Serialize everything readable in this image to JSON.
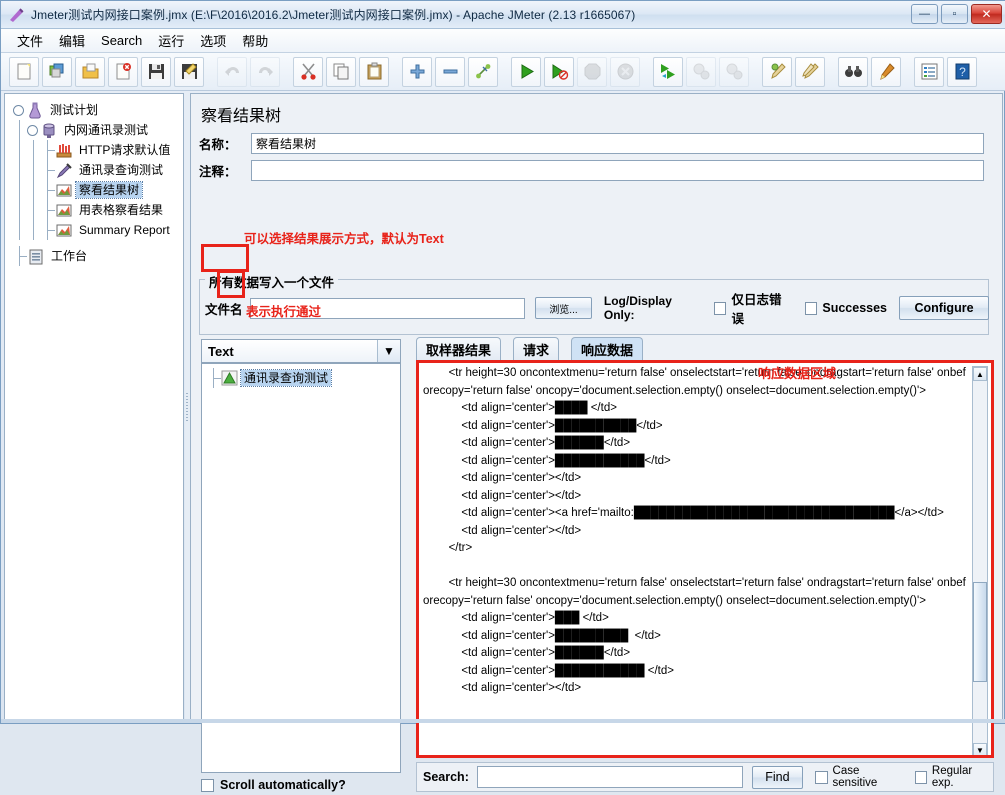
{
  "window": {
    "title": "Jmeter测试内网接口案例.jmx (E:\\F\\2016\\2016.2\\Jmeter测试内网接口案例.jmx) - Apache JMeter (2.13 r1665067)",
    "minimize_label": "—",
    "maximize_label": "▫",
    "close_label": "✕"
  },
  "menubar": {
    "items": [
      {
        "label": "文件"
      },
      {
        "label": "编辑"
      },
      {
        "label": "Search"
      },
      {
        "label": "运行"
      },
      {
        "label": "选项"
      },
      {
        "label": "帮助"
      }
    ]
  },
  "toolbar": {
    "buttons": [
      {
        "name": "new-icon",
        "enabled": true
      },
      {
        "name": "templates-icon",
        "enabled": true
      },
      {
        "name": "open-icon",
        "enabled": true
      },
      {
        "name": "close-icon",
        "enabled": true
      },
      {
        "name": "save-icon",
        "enabled": true
      },
      {
        "name": "save-as-icon",
        "enabled": true
      },
      {
        "name": "undo-icon",
        "enabled": false
      },
      {
        "name": "redo-icon",
        "enabled": false
      },
      {
        "name": "cut-icon",
        "enabled": true
      },
      {
        "name": "copy-icon",
        "enabled": true
      },
      {
        "name": "paste-icon",
        "enabled": true
      },
      {
        "name": "expand-all-icon",
        "enabled": true
      },
      {
        "name": "collapse-all-icon",
        "enabled": true
      },
      {
        "name": "toggle-icon",
        "enabled": true
      },
      {
        "name": "start-icon",
        "enabled": true
      },
      {
        "name": "start-no-timers-icon",
        "enabled": true
      },
      {
        "name": "stop-icon",
        "enabled": false
      },
      {
        "name": "shutdown-icon",
        "enabled": false
      },
      {
        "name": "start-remote-all-icon",
        "enabled": true
      },
      {
        "name": "stop-remote-all-icon",
        "enabled": false
      },
      {
        "name": "shutdown-remote-all-icon",
        "enabled": false
      },
      {
        "name": "clear-icon",
        "enabled": true
      },
      {
        "name": "clear-all-icon",
        "enabled": true
      },
      {
        "name": "search-icon",
        "enabled": true
      },
      {
        "name": "reset-search-icon",
        "enabled": true
      },
      {
        "name": "function-helper-icon",
        "enabled": true
      },
      {
        "name": "help-icon",
        "enabled": true
      }
    ]
  },
  "tree": {
    "items": [
      {
        "label": "测试计划",
        "icon": "test-plan-icon",
        "depth": 0,
        "selected": false,
        "handle": true
      },
      {
        "label": "内网通讯录测试",
        "icon": "thread-group-icon",
        "depth": 1,
        "selected": false,
        "handle": true
      },
      {
        "label": "HTTP请求默认值",
        "icon": "http-defaults-icon",
        "depth": 2,
        "selected": false,
        "handle": false
      },
      {
        "label": "通讯录查询测试",
        "icon": "http-sampler-icon",
        "depth": 2,
        "selected": false,
        "handle": false
      },
      {
        "label": "察看结果树",
        "icon": "view-results-tree-icon",
        "depth": 2,
        "selected": true,
        "handle": false
      },
      {
        "label": "用表格察看结果",
        "icon": "view-results-table-icon",
        "depth": 2,
        "selected": false,
        "handle": false
      },
      {
        "label": "Summary Report",
        "icon": "summary-report-icon",
        "depth": 2,
        "selected": false,
        "handle": false
      },
      {
        "label": "工作台",
        "icon": "workbench-icon",
        "depth": 0,
        "selected": false,
        "handle": false
      }
    ]
  },
  "panel": {
    "title": "察看结果树",
    "name_label": "名称：",
    "name_value": "察看结果树",
    "comment_label": "注释：",
    "comment_value": "",
    "group_title": "所有数据写入一个文件",
    "filename_label": "文件名",
    "filename_value": "",
    "filename_placeholder": "",
    "browse_button": "浏览...",
    "log_display_only_label": "Log/Display Only:",
    "errors_only_label": "仅日志错误",
    "successes_label": "Successes",
    "configure_button": "Configure",
    "errors_only_checked": false,
    "successes_checked": false
  },
  "renderer": {
    "selected": "Text",
    "arrow": "▼"
  },
  "result_list": {
    "items": [
      {
        "label": "通讯录查询测试",
        "status": "pass",
        "selected": true
      }
    ]
  },
  "tabs": [
    {
      "label": "取样器结果",
      "active": false
    },
    {
      "label": "请求",
      "active": false
    },
    {
      "label": "响应数据",
      "active": true
    }
  ],
  "response": {
    "text": "        <tr height=30 oncontextmenu='return false' onselectstart='return false' ondragstart='return false' onbeforecopy='return false' oncopy='document.selection.empty() onselect=document.selection.empty()'>\n            <td align='center'>████ </td>\n            <td align='center'>██████████</td>\n            <td align='center'>██████</td>\n            <td align='center'>███████████</td>\n            <td align='center'></td>\n            <td align='center'></td>\n            <td align='center'><a href='mailto:████████████████████████████████</a></td>\n            <td align='center'></td>\n        </tr>\n\n        <tr height=30 oncontextmenu='return false' onselectstart='return false' ondragstart='return false' onbeforecopy='return false' oncopy='document.selection.empty() onselect=document.selection.empty()'>\n            <td align='center'>███ </td>\n            <td align='center'>█████████  </td>\n            <td align='center'>██████</td>\n            <td align='center'>███████████ </td>\n            <td align='center'></td>"
  },
  "search": {
    "label": "Search:",
    "value": "",
    "find_button": "Find",
    "case_sensitive_label": "Case sensitive",
    "regular_exp_label": "Regular exp.",
    "case_sensitive_checked": false,
    "regular_exp_checked": false
  },
  "bottom": {
    "scroll_automatically_label": "Scroll automatically?",
    "scroll_automatically_checked": false
  },
  "annotations": [
    {
      "id": "renderer_note",
      "text": "可以选择结果展示方式，默认为Text"
    },
    {
      "id": "pass_note",
      "text": "表示执行通过"
    },
    {
      "id": "response_area_note",
      "text": "响应数据区域"
    }
  ],
  "colors": {
    "annotation_red": "#e8231a",
    "selection_blue": "#b8d4f0",
    "tab_active": "#cfe2f5"
  }
}
